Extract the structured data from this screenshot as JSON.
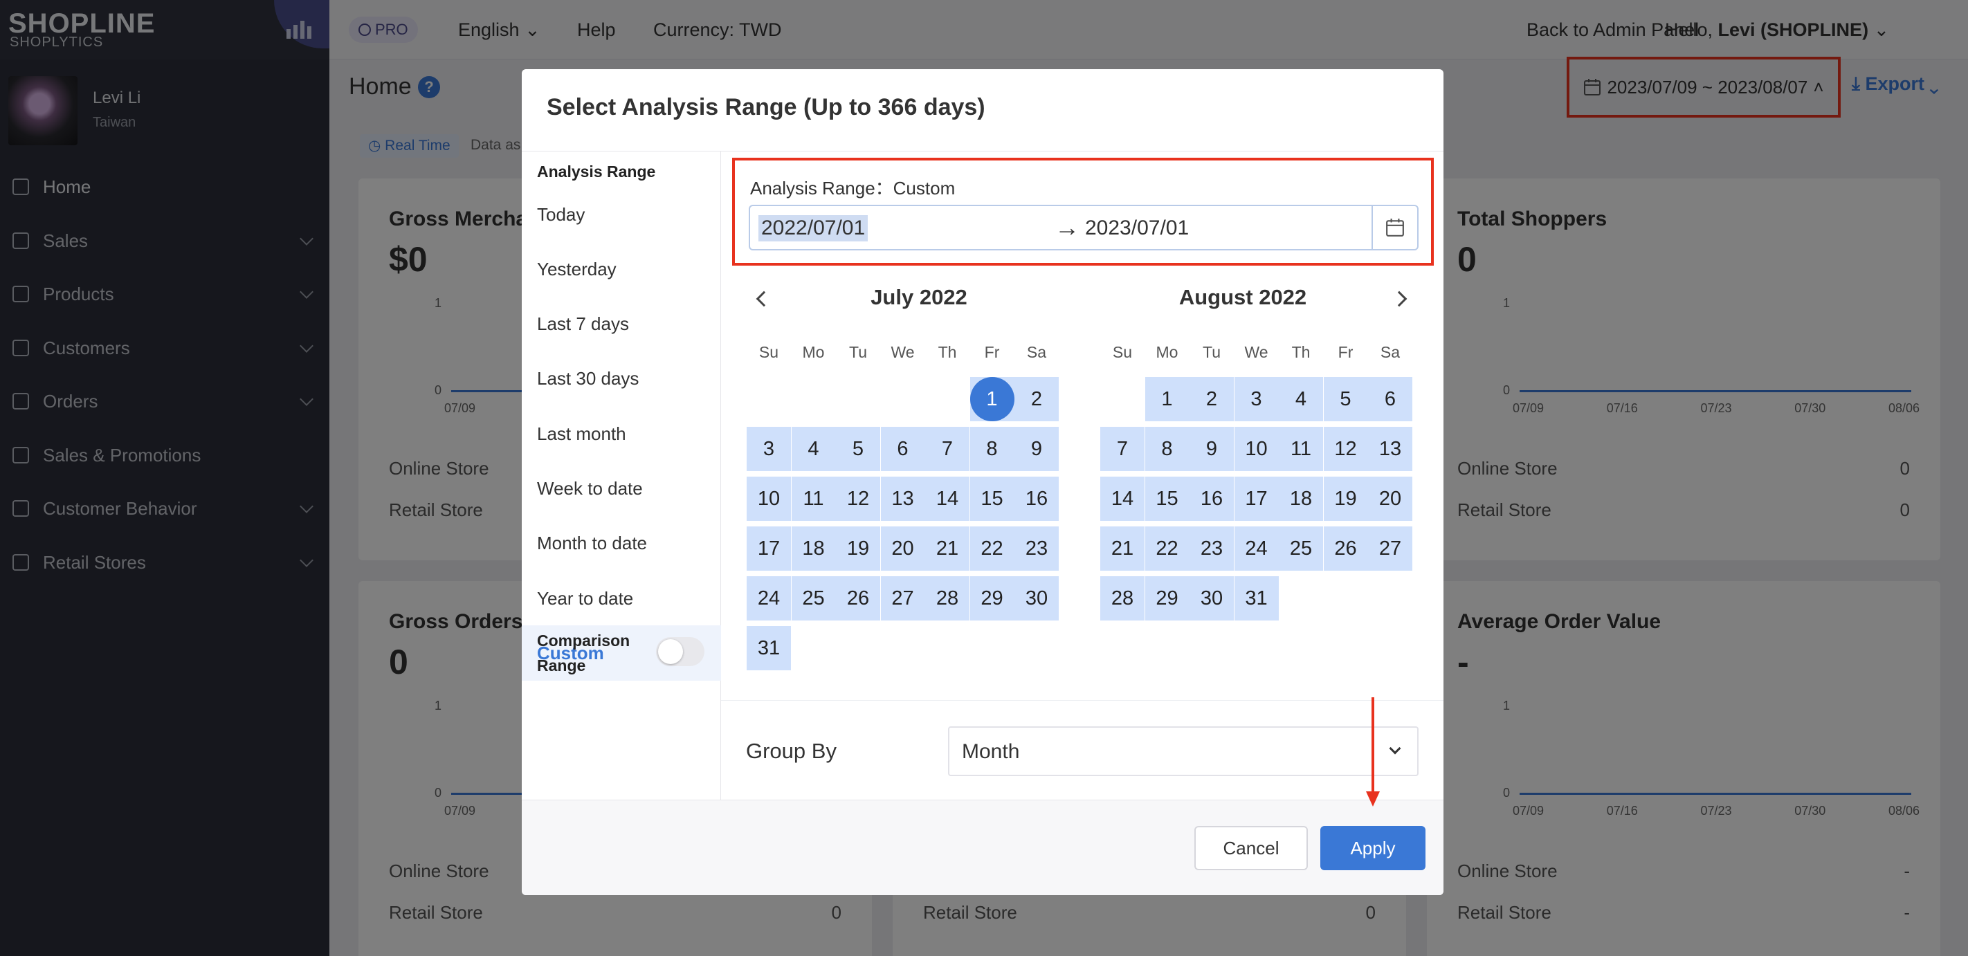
{
  "brand": {
    "name": "SHOPLINE",
    "product": "SHOPLYTICS"
  },
  "profile": {
    "name": "Levi Li",
    "country": "Taiwan"
  },
  "sidebar": {
    "items": [
      {
        "label": "Home",
        "icon": "home-icon"
      },
      {
        "label": "Sales",
        "icon": "cart-icon"
      },
      {
        "label": "Products",
        "icon": "bag-icon"
      },
      {
        "label": "Customers",
        "icon": "user-icon"
      },
      {
        "label": "Orders",
        "icon": "receipt-icon"
      },
      {
        "label": "Sales & Promotions",
        "icon": "tag-icon"
      },
      {
        "label": "Customer Behavior",
        "icon": "behavior-icon"
      },
      {
        "label": "Retail Stores",
        "icon": "store-icon"
      }
    ]
  },
  "topbar": {
    "pro": "PRO",
    "language": "English",
    "help": "Help",
    "currency": "Currency: TWD",
    "back": "Back to Admin Panel",
    "hello": "Hello, ",
    "user": "Levi (SHOPLINE)"
  },
  "page": {
    "title": "Home",
    "date_range": "2023/07/09 ~ 2023/08/07",
    "export": "Export",
    "realtime": "Real Time",
    "data_as": "Data as"
  },
  "cards": {
    "gross_merch": {
      "title": "Gross Merchandise",
      "value": "$0"
    },
    "total_shoppers": {
      "title": "Total Shoppers",
      "value": "0",
      "online": "0",
      "retail": "0"
    },
    "gross_orders": {
      "title": "Gross Orders",
      "value": "0",
      "retail": "0"
    },
    "middle_bottom": {
      "retail": "0"
    },
    "aov": {
      "title": "Average Order Value",
      "value": "-",
      "online": "-",
      "retail": "-"
    },
    "online_label": "Online Store",
    "retail_label": "Retail Store",
    "axis_top": "1",
    "axis_zero": "0",
    "xticks": [
      "07/09",
      "07/16",
      "07/23",
      "07/30",
      "08/06"
    ]
  },
  "modal": {
    "title": "Select Analysis Range (Up to 366 days)",
    "left_header": "Analysis Range",
    "presets": [
      "Today",
      "Yesterday",
      "Last 7 days",
      "Last 30 days",
      "Last month",
      "Week to date",
      "Month to date",
      "Year to date",
      "Custom"
    ],
    "comparison_label": "Comparison Range",
    "range_label": "Analysis Range：Custom",
    "start_date": "2022/07/01",
    "end_date": "2023/07/01",
    "weekdays": [
      "Su",
      "Mo",
      "Tu",
      "We",
      "Th",
      "Fr",
      "Sa"
    ],
    "month_left": "July 2022",
    "month_right": "August 2022",
    "group_by_label": "Group By",
    "group_by_value": "Month",
    "cancel": "Cancel",
    "apply": "Apply",
    "selected_day": "1"
  },
  "colors": {
    "accent": "#3a78d6",
    "highlight": "#e8321e",
    "range_fill": "#cfe0fb"
  }
}
